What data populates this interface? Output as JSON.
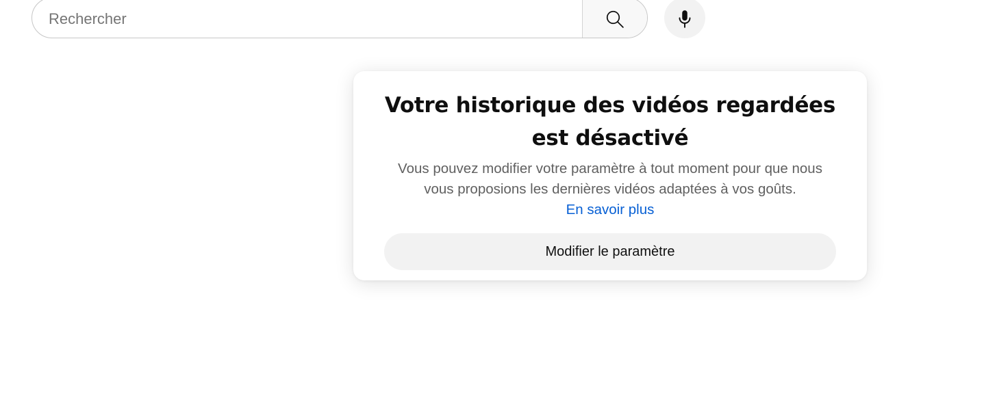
{
  "search": {
    "placeholder": "Rechercher",
    "value": "",
    "search_icon": "search-icon",
    "mic_icon": "microphone-icon"
  },
  "card": {
    "title": "Votre historique des vidéos regardées est désactivé",
    "description": "Vous pouvez modifier votre paramètre à tout moment pour que nous vous proposions les dernières vidéos adaptées à vos goûts.",
    "link_label": "En savoir plus",
    "button_label": "Modifier le paramètre"
  },
  "colors": {
    "link": "#065fd4",
    "title": "#0f0f0f",
    "description": "#606060",
    "button_bg": "#f2f2f2"
  }
}
